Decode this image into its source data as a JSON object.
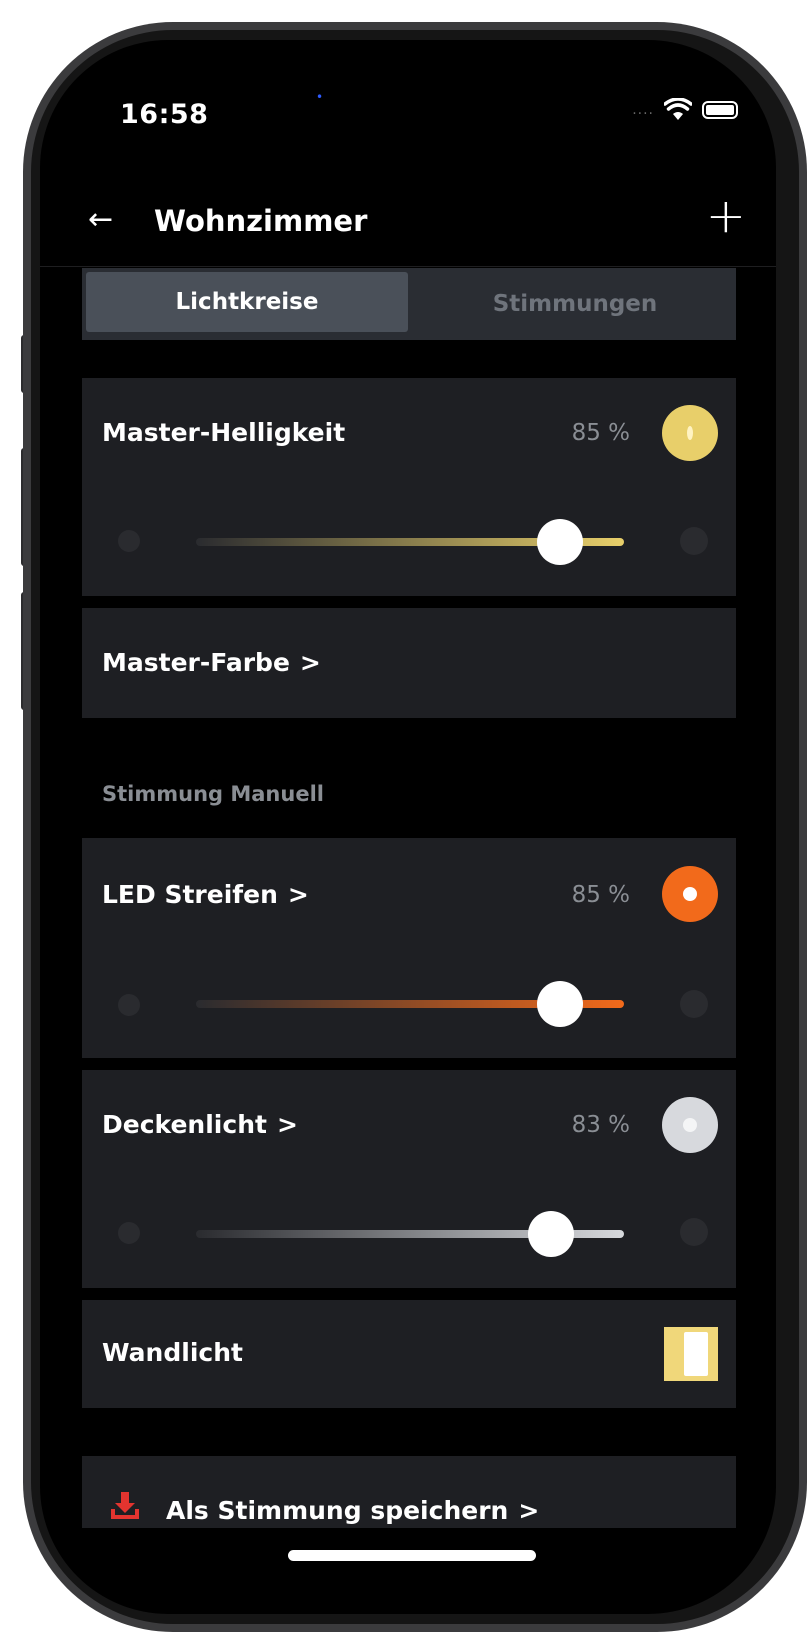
{
  "status": {
    "time": "16:58"
  },
  "nav": {
    "title": "Wohnzimmer",
    "back_icon": "arrow-left-icon",
    "add_icon": "plus-icon"
  },
  "tabs": [
    {
      "label": "Lichtkreise",
      "active": true
    },
    {
      "label": "Stimmungen",
      "active": false
    }
  ],
  "master": {
    "brightness_label": "Master-Helligkeit",
    "brightness_value": "85 %",
    "brightness_level": 0.85,
    "accent": "#e8cf6a",
    "color_label": "Master-Farbe",
    "chevron": ">"
  },
  "section_title": "Stimmung Manuell",
  "lights": [
    {
      "label": "LED Streifen",
      "value": "85 %",
      "level": 0.85,
      "color": "#f26a1b",
      "chevron": ">"
    },
    {
      "label": "Deckenlicht",
      "value": "83 %",
      "level": 0.83,
      "color": "#d7d9dd",
      "chevron": ">"
    },
    {
      "label": "Wandlicht",
      "switch_color": "#f0d77a",
      "on": true
    }
  ],
  "save": {
    "label": "Als Stimmung speichern",
    "chevron": ">",
    "icon_color": "#e3342f"
  }
}
